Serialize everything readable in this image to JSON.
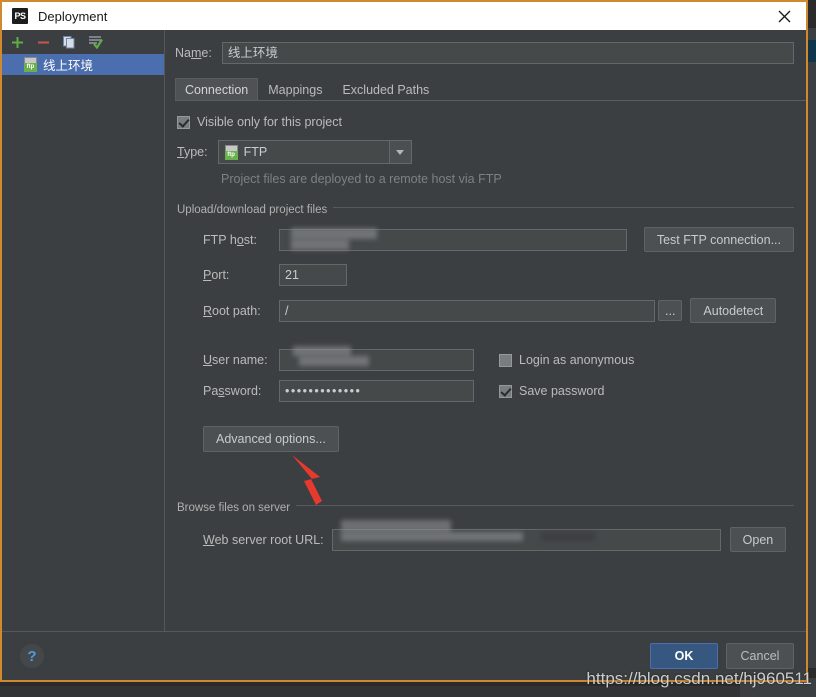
{
  "window": {
    "title": "Deployment",
    "app_icon": "phpstorm-icon",
    "close_icon": "close-icon",
    "border_color": "#d0892f"
  },
  "left_panel": {
    "toolbar": [
      {
        "name": "add-server-button",
        "icon": "plus-icon",
        "symbol": "+",
        "color": "#5fad45"
      },
      {
        "name": "remove-server-button",
        "icon": "minus-icon",
        "symbol": "−",
        "color": "#c75450"
      },
      {
        "name": "copy-server-button",
        "icon": "copy-icon",
        "color": "#7f9bbd"
      },
      {
        "name": "set-default-button",
        "icon": "check-lines-icon",
        "color": "#5fad45"
      }
    ],
    "items": [
      {
        "label": "线上环境",
        "icon": "ftp-server-icon",
        "selected": true
      }
    ],
    "selection_color": "#4b6eaf"
  },
  "form": {
    "name_label": "Name:",
    "name_value": "线上环境"
  },
  "tabs": [
    {
      "label": "Connection",
      "active": true
    },
    {
      "label": "Mappings",
      "active": false
    },
    {
      "label": "Excluded Paths",
      "active": false
    }
  ],
  "connection": {
    "visible_only_label": "Visible only for this project",
    "visible_only_checked": true,
    "type_label": "Type:",
    "type_value": "FTP",
    "type_icon": "ftp-type-icon",
    "type_hint": "Project files are deployed to a remote host via FTP",
    "upload_group_title": "Upload/download project files",
    "ftp_host_label": "FTP host:",
    "ftp_host_value": "",
    "ftp_host_redacted": true,
    "test_connection_label": "Test FTP connection...",
    "port_label": "Port:",
    "port_value": "21",
    "root_path_label": "Root path:",
    "root_path_value": "/",
    "root_browse_label": "...",
    "autodetect_label": "Autodetect",
    "user_name_label": "User name:",
    "user_name_value": "",
    "user_name_redacted": true,
    "login_anonymous_label": "Login as anonymous",
    "login_anonymous_checked": false,
    "password_label": "Password:",
    "password_value": "•••••••••••••",
    "save_password_label": "Save password",
    "save_password_checked": true,
    "advanced_options_label": "Advanced options...",
    "browse_group_title": "Browse files on server",
    "web_root_label": "Web server root URL:",
    "web_root_value": "",
    "web_root_redacted": true,
    "open_label": "Open"
  },
  "footer": {
    "help_label": "?",
    "ok_label": "OK",
    "cancel_label": "Cancel"
  },
  "annotation": {
    "arrow_color": "#e8392e",
    "points_to": "advanced-options-button"
  },
  "watermark": {
    "text": "https://blog.csdn.net/hj960511"
  }
}
